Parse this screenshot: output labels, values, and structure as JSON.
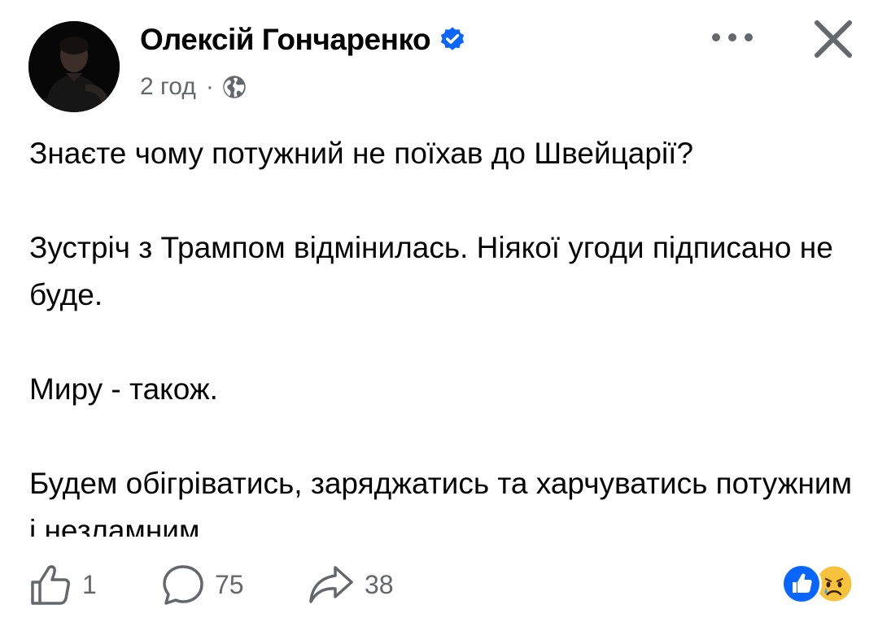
{
  "post": {
    "author": {
      "name": "Олексій Гончаренко",
      "verified": true,
      "verified_icon": "verified-badge-icon",
      "avatar_icon": "avatar"
    },
    "meta": {
      "time": "2 год",
      "separator": "·",
      "privacy_icon": "globe-icon"
    },
    "header_actions": {
      "more_icon": "more-options-icon",
      "close_icon": "close-icon"
    },
    "body": {
      "paragraphs": [
        "Знаєте чому потужний не поїхав до Швейцарії?",
        "Зустріч з Трампом відмінилась. Ніякої угоди підписано не буде.",
        "Миру - також.",
        "Будем обігріватись, заряджатись та харчуватись потужним і незламним."
      ]
    },
    "footer": {
      "likes": "1",
      "comments": "75",
      "shares": "38",
      "reactions": [
        "like-reaction-icon",
        "sad-reaction-icon"
      ]
    }
  },
  "colors": {
    "text": "#050505",
    "secondary": "#65676b",
    "accent": "#0866ff",
    "background": "#ffffff"
  }
}
